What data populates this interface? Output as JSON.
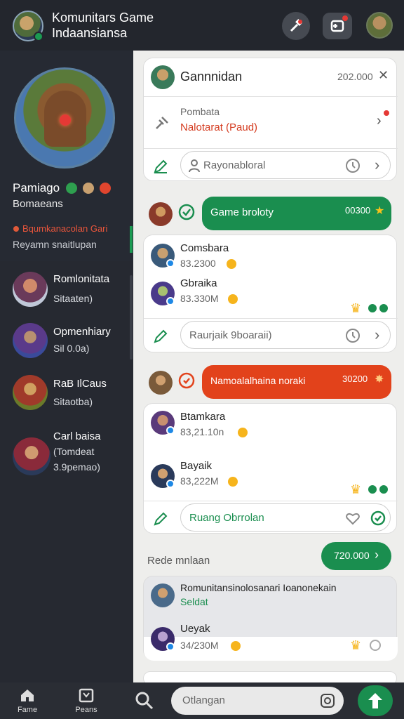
{
  "header": {
    "title_line1": "Komunitars Game",
    "title_line2": "Indaansiansa"
  },
  "profile": {
    "name": "Pamiago",
    "subtitle": "Bomaeans",
    "status": "Bqumkanacolan Gari",
    "description": "Reyamn snaitlupan"
  },
  "sidebar": {
    "items": [
      {
        "line1": "Romlonitata",
        "line2": "Sitaaten)"
      },
      {
        "line1": "Opmenhiary",
        "line2": "Sil 0.0a)"
      },
      {
        "line1": "RaB IlCaus",
        "line2": "Sitaotba)"
      },
      {
        "line1": "Carl baisa",
        "line2": "(Tomdeat",
        "line3": "3.9pemao)"
      }
    ]
  },
  "cards": {
    "card1": {
      "title": "Gannnidan",
      "count": "202.000",
      "sub_label": "Pombata",
      "sub_value": "Nalotarat (Paud)",
      "input_placeholder": "Rayonabloral"
    },
    "card2": {
      "banner": "Game broloty",
      "banner_value": "00300",
      "rows": [
        {
          "name": "Comsbara",
          "value": "83.2300"
        },
        {
          "name": "Gbraika",
          "value": "83.330M"
        }
      ],
      "input_placeholder": "Raurjaik 9boaraii)"
    },
    "card3": {
      "banner": "Namoalalhaina noraki",
      "banner_value": "30200",
      "rows": [
        {
          "name": "Btamkara",
          "value": "83,21.10n"
        },
        {
          "name": "Bayaik",
          "value": "83,222M"
        }
      ],
      "input_placeholder": "Ruang Obrrolan"
    },
    "section_label": "Rede mnlaan",
    "section_button": "720.000",
    "card4": {
      "title": "Romunitansinolosanari Ioanonekain",
      "subtitle": "Seldat",
      "row_name": "Ueyak",
      "row_value": "34/230M"
    }
  },
  "bottom_nav": {
    "home": "Fame",
    "second": "Peans",
    "search_placeholder": "Otlangan"
  },
  "colors": {
    "green": "#1a8e4f",
    "orange": "#e2421b",
    "blue": "#1e88e5"
  }
}
